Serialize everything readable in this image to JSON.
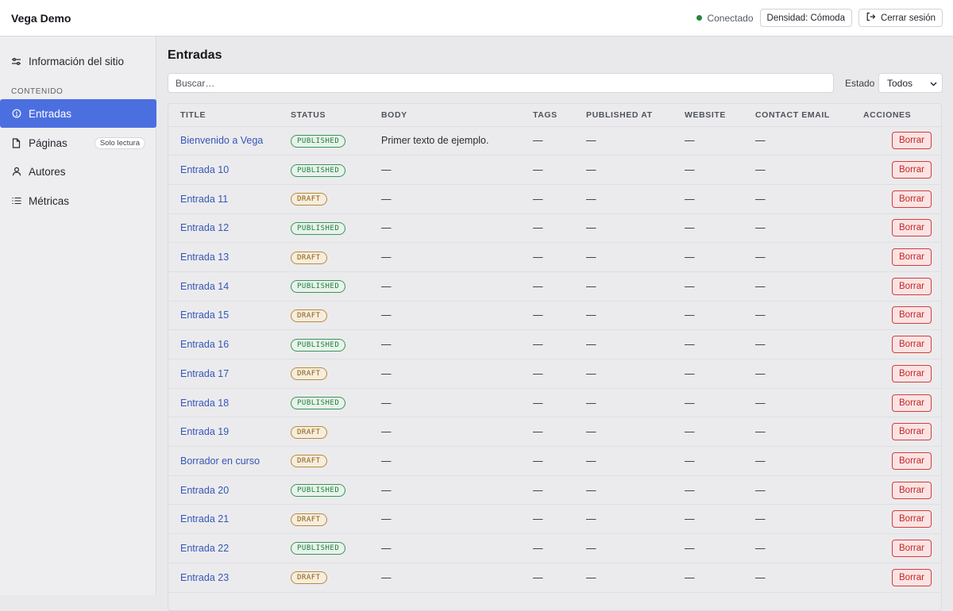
{
  "app": {
    "title": "Vega Demo"
  },
  "header": {
    "status": "Conectado",
    "density_button": "Densidad: Cómoda",
    "logout_button": "Cerrar sesión"
  },
  "sidebar": {
    "site_info": "Información del sitio",
    "section_label": "CONTENIDO",
    "items": [
      {
        "label": "Entradas",
        "icon": "info-circle-icon",
        "active": true
      },
      {
        "label": "Páginas",
        "icon": "document-icon",
        "badge": "Solo lectura"
      },
      {
        "label": "Autores",
        "icon": "user-icon"
      },
      {
        "label": "Métricas",
        "icon": "list-icon"
      }
    ]
  },
  "main": {
    "title": "Entradas",
    "search_placeholder": "Buscar…",
    "filter_label": "Estado",
    "filter_value": "Todos"
  },
  "table": {
    "columns": [
      "TITLE",
      "STATUS",
      "BODY",
      "TAGS",
      "PUBLISHED AT",
      "WEBSITE",
      "CONTACT EMAIL",
      "ACCIONES"
    ],
    "delete_label": "Borrar",
    "rows": [
      {
        "title": "Bienvenido a Vega",
        "status": "PUBLISHED",
        "body": "Primer texto de ejemplo.",
        "tags": "—",
        "published_at": "—",
        "website": "—",
        "email": "—"
      },
      {
        "title": "Entrada 10",
        "status": "PUBLISHED",
        "body": "—",
        "tags": "—",
        "published_at": "—",
        "website": "—",
        "email": "—"
      },
      {
        "title": "Entrada 11",
        "status": "DRAFT",
        "body": "—",
        "tags": "—",
        "published_at": "—",
        "website": "—",
        "email": "—"
      },
      {
        "title": "Entrada 12",
        "status": "PUBLISHED",
        "body": "—",
        "tags": "—",
        "published_at": "—",
        "website": "—",
        "email": "—"
      },
      {
        "title": "Entrada 13",
        "status": "DRAFT",
        "body": "—",
        "tags": "—",
        "published_at": "—",
        "website": "—",
        "email": "—"
      },
      {
        "title": "Entrada 14",
        "status": "PUBLISHED",
        "body": "—",
        "tags": "—",
        "published_at": "—",
        "website": "—",
        "email": "—"
      },
      {
        "title": "Entrada 15",
        "status": "DRAFT",
        "body": "—",
        "tags": "—",
        "published_at": "—",
        "website": "—",
        "email": "—"
      },
      {
        "title": "Entrada 16",
        "status": "PUBLISHED",
        "body": "—",
        "tags": "—",
        "published_at": "—",
        "website": "—",
        "email": "—"
      },
      {
        "title": "Entrada 17",
        "status": "DRAFT",
        "body": "—",
        "tags": "—",
        "published_at": "—",
        "website": "—",
        "email": "—"
      },
      {
        "title": "Entrada 18",
        "status": "PUBLISHED",
        "body": "—",
        "tags": "—",
        "published_at": "—",
        "website": "—",
        "email": "—"
      },
      {
        "title": "Entrada 19",
        "status": "DRAFT",
        "body": "—",
        "tags": "—",
        "published_at": "—",
        "website": "—",
        "email": "—"
      },
      {
        "title": "Borrador en curso",
        "status": "DRAFT",
        "body": "—",
        "tags": "—",
        "published_at": "—",
        "website": "—",
        "email": "—"
      },
      {
        "title": "Entrada 20",
        "status": "PUBLISHED",
        "body": "—",
        "tags": "—",
        "published_at": "—",
        "website": "—",
        "email": "—"
      },
      {
        "title": "Entrada 21",
        "status": "DRAFT",
        "body": "—",
        "tags": "—",
        "published_at": "—",
        "website": "—",
        "email": "—"
      },
      {
        "title": "Entrada 22",
        "status": "PUBLISHED",
        "body": "—",
        "tags": "—",
        "published_at": "—",
        "website": "—",
        "email": "—"
      },
      {
        "title": "Entrada 23",
        "status": "DRAFT",
        "body": "—",
        "tags": "—",
        "published_at": "—",
        "website": "—",
        "email": "—"
      }
    ]
  },
  "colors": {
    "accent": "#4c6fe0",
    "link": "#3656b7",
    "published": "#1f7a3e",
    "draft": "#8a5a12",
    "danger": "#c02727",
    "connected": "#1f8a3b"
  }
}
